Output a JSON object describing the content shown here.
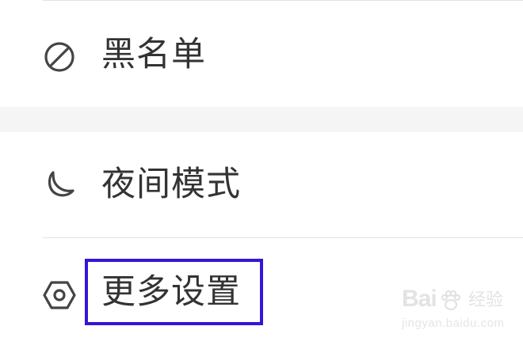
{
  "settings": {
    "items": [
      {
        "label": "黑名单",
        "icon": "block-icon"
      },
      {
        "label": "夜间模式",
        "icon": "moon-icon"
      },
      {
        "label": "更多设置",
        "icon": "hexagon-settings-icon"
      }
    ]
  },
  "highlight": {
    "color": "#3316d9"
  },
  "watermark": {
    "logo": "Bai",
    "logo_suffix": "经验",
    "url": "jingyan.baidu.com"
  }
}
